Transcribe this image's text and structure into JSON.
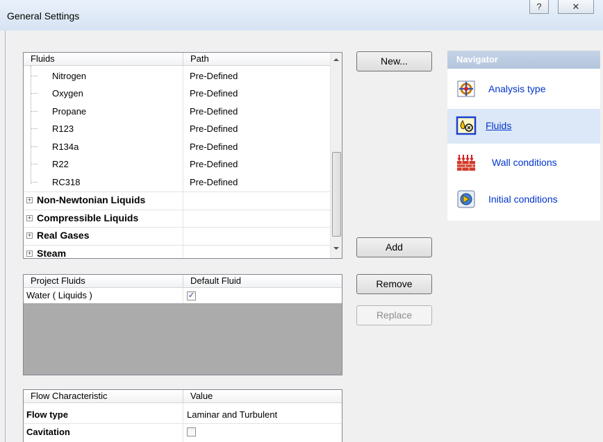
{
  "window": {
    "title": "General Settings",
    "help_glyph": "?",
    "close_glyph": "✕"
  },
  "fluids_table": {
    "headers": [
      "Fluids",
      "Path"
    ],
    "rows": [
      {
        "name": "Nitrogen",
        "path": "Pre-Defined"
      },
      {
        "name": "Oxygen",
        "path": "Pre-Defined"
      },
      {
        "name": "Propane",
        "path": "Pre-Defined"
      },
      {
        "name": "R123",
        "path": "Pre-Defined"
      },
      {
        "name": "R134a",
        "path": "Pre-Defined"
      },
      {
        "name": "R22",
        "path": "Pre-Defined"
      },
      {
        "name": "RC318",
        "path": "Pre-Defined"
      }
    ],
    "groups": [
      "Non-Newtonian Liquids",
      "Compressible Liquids",
      "Real Gases",
      "Steam"
    ],
    "expand_glyph": "+"
  },
  "project_fluids": {
    "headers": [
      "Project Fluids",
      "Default Fluid"
    ],
    "rows": [
      {
        "name": "Water ( Liquids )",
        "default": true
      }
    ],
    "check_glyph": "✓"
  },
  "flow_table": {
    "headers": [
      "Flow Characteristic",
      "Value"
    ],
    "rows": [
      {
        "name": "Flow type",
        "value": "Laminar and Turbulent"
      },
      {
        "name": "Cavitation",
        "value": ""
      }
    ]
  },
  "buttons": {
    "new": "New...",
    "add": "Add",
    "remove": "Remove",
    "replace": "Replace"
  },
  "navigator": {
    "title": "Navigator",
    "items": [
      {
        "label": "Analysis type",
        "icon": "analysis-type-icon",
        "selected": false
      },
      {
        "label": "Fluids",
        "icon": "fluids-icon",
        "selected": true
      },
      {
        "label": "Wall conditions",
        "icon": "wall-conditions-icon",
        "selected": false
      },
      {
        "label": "Initial conditions",
        "icon": "initial-conditions-icon",
        "selected": false
      }
    ],
    "selected_bg": "#dce8f7",
    "link_color": "#0033cc"
  }
}
